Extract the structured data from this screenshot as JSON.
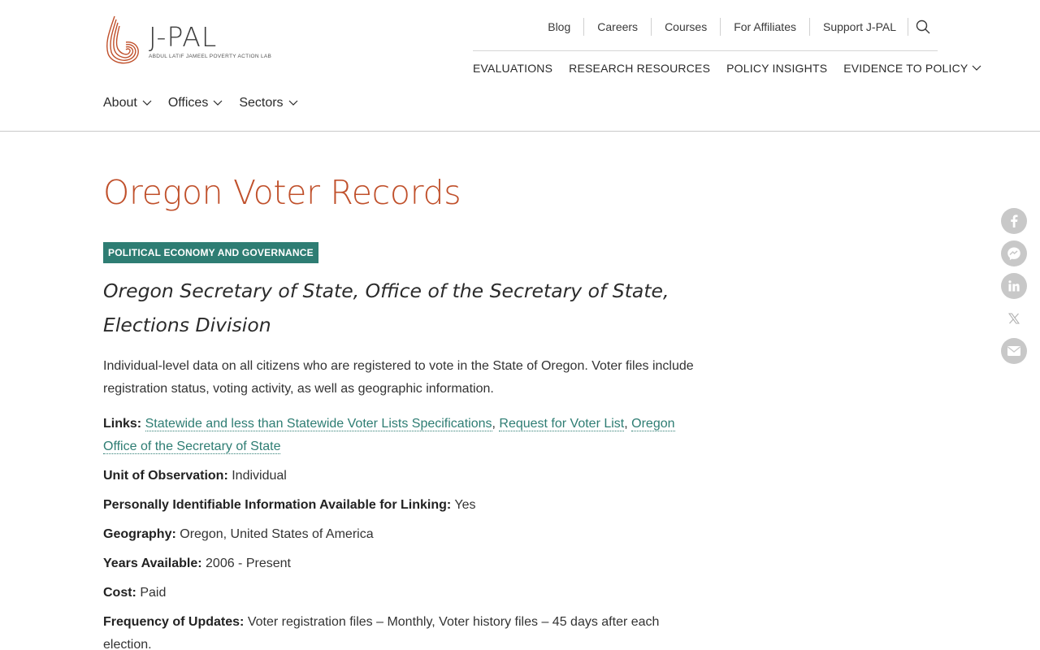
{
  "header": {
    "logo": {
      "wordmark": "J-PAL",
      "subtitle": "ABDUL LATIF JAMEEL POVERTY ACTION LAB"
    },
    "utility_links": [
      "Blog",
      "Careers",
      "Courses",
      "For Affiliates",
      "Support J-PAL"
    ],
    "search_icon": "search-icon",
    "main_nav": [
      "EVALUATIONS",
      "RESEARCH RESOURCES",
      "POLICY INSIGHTS",
      "EVIDENCE TO POLICY"
    ],
    "sub_nav": [
      "About",
      "Offices",
      "Sectors"
    ]
  },
  "page": {
    "title": "Oregon Voter Records",
    "sector_badge": "POLITICAL ECONOMY AND GOVERNANCE",
    "source": "Oregon Secretary of State, Office of the Secretary of State, Elections Division",
    "description": "Individual-level data on all citizens who are registered to vote in the State of Oregon. Voter files include registration status, voting activity, as well as geographic information.",
    "links_label": "Links:",
    "links": [
      "Statewide and less than Statewide Voter Lists Specifications",
      "Request for Voter List",
      "Oregon Office of the Secretary of State"
    ],
    "fields": [
      {
        "label": "Unit of Observation:",
        "value": "Individual"
      },
      {
        "label": "Personally Identifiable Information Available for Linking:",
        "value": "Yes"
      },
      {
        "label": "Geography:",
        "value": "Oregon, United States of America"
      },
      {
        "label": "Years Available:",
        "value": "2006 - Present"
      },
      {
        "label": "Cost:",
        "value": "Paid"
      },
      {
        "label": "Frequency of Updates:",
        "value": "Voter registration files – Monthly, Voter history files – 45 days after each election."
      }
    ]
  },
  "share": [
    "facebook-icon",
    "messenger-icon",
    "linkedin-icon",
    "x-icon",
    "email-icon"
  ],
  "colors": {
    "accent": "#c0502b",
    "badge": "#2e7d73",
    "link": "#2e7d73",
    "share_button": "#c8c8c8"
  }
}
